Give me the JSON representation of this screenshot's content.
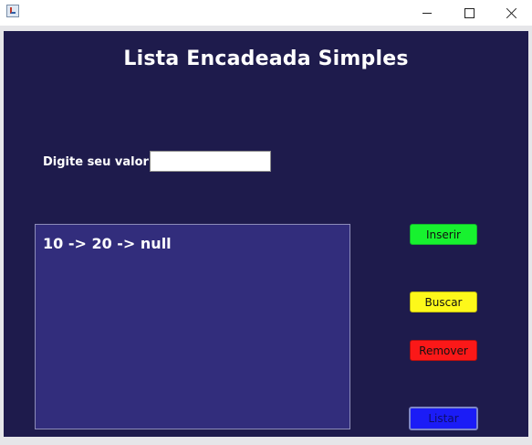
{
  "window": {
    "icon": "java-cup-icon",
    "controls": {
      "minimize": "minimize-icon",
      "maximize": "maximize-icon",
      "close": "close-icon"
    }
  },
  "colors": {
    "background": "#1e1b4c",
    "output_area": "#322d7c",
    "inserir": "#17f22f",
    "buscar": "#fdf81a",
    "remover": "#fb1818",
    "listar": "#1b1cf6"
  },
  "header": {
    "title": "Lista Encadeada Simples"
  },
  "form": {
    "label": "Digite seu valor:",
    "value": "",
    "placeholder": ""
  },
  "output": {
    "text": "10 -> 20 -> null"
  },
  "buttons": {
    "inserir": "Inserir",
    "buscar": "Buscar",
    "remover": "Remover",
    "listar": "Listar"
  }
}
